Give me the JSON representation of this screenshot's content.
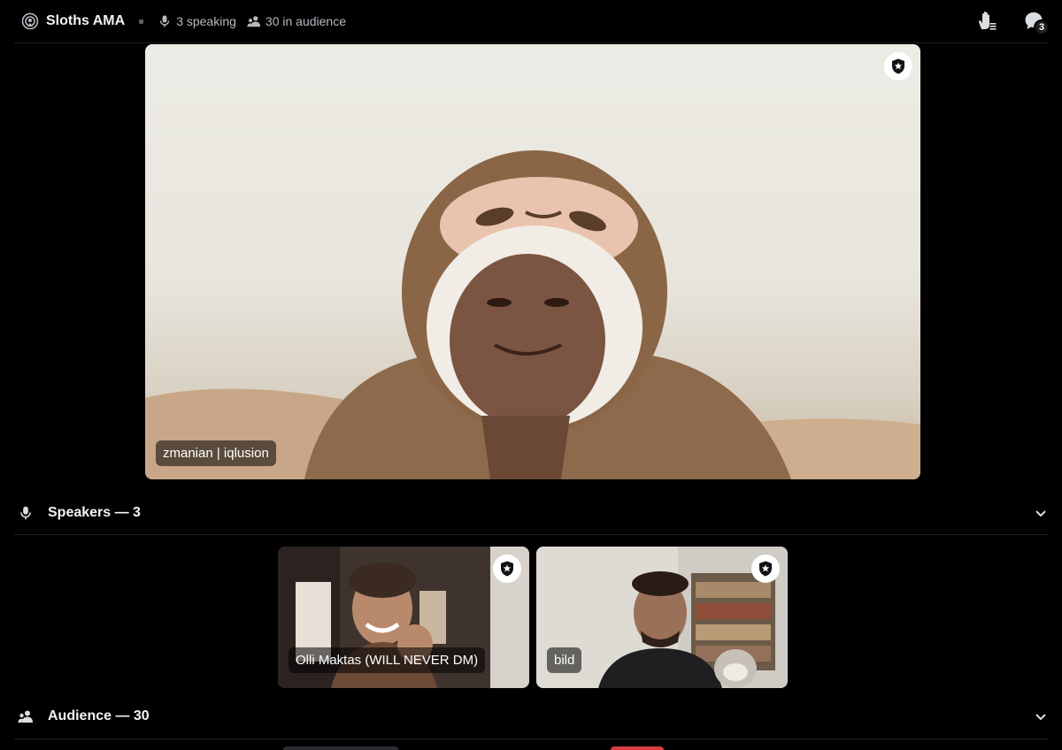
{
  "header": {
    "title": "Sloths AMA",
    "speaking": "3 speaking",
    "audience": "30 in audience",
    "notification_count": "3"
  },
  "main_speaker": {
    "name": "zmanian | iqlusion"
  },
  "speakers_section": {
    "label": "Speakers — 3",
    "tiles": [
      {
        "name": "Olli Maktas (WILL NEVER DM)"
      },
      {
        "name": "bild"
      }
    ]
  },
  "audience_section": {
    "label": "Audience — 30"
  },
  "colors": {
    "background": "#000000",
    "active_speaker_border": "#6fae7b",
    "muted_text": "#b5bac1"
  }
}
